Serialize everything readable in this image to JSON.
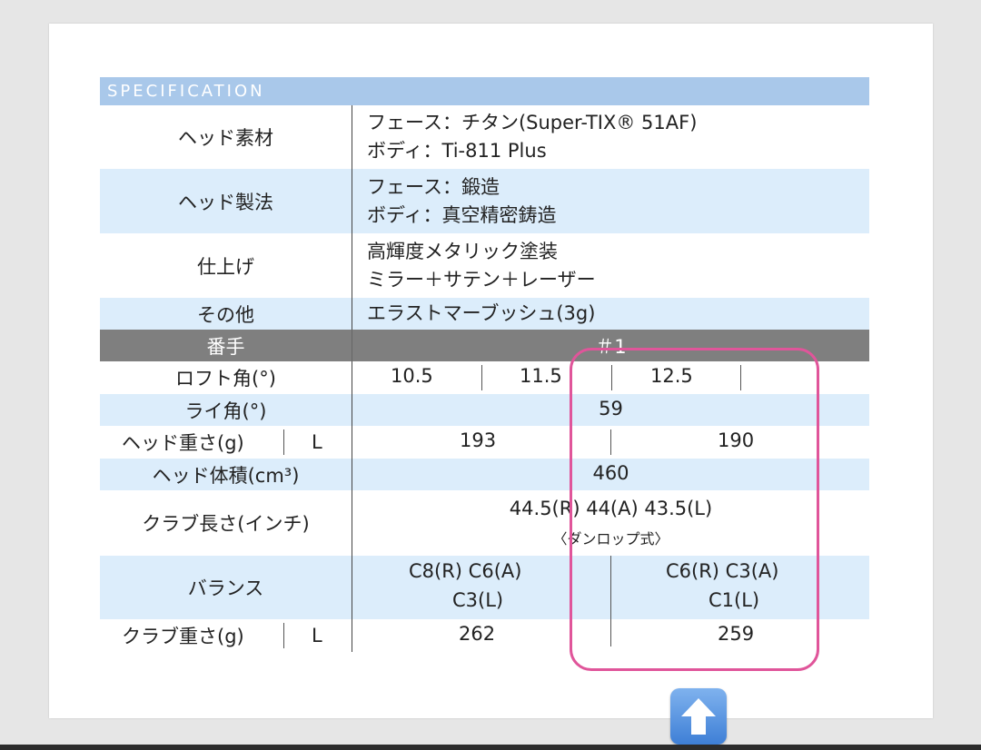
{
  "spec": {
    "header": "SPECIFICATION",
    "head_material": {
      "label": "ヘッド素材",
      "line1": "フェース：チタン(Super-TIX® 51AF)",
      "line2": "ボディ：Ti-811 Plus"
    },
    "head_manufacturing": {
      "label": "ヘッド製法",
      "line1": "フェース：鍛造",
      "line2": "ボディ：真空精密鋳造"
    },
    "finish": {
      "label": "仕上げ",
      "line1": "高輝度メタリック塗装",
      "line2": "ミラー＋サテン＋レーザー"
    },
    "other": {
      "label": "その他",
      "value": "エラストマーブッシュ(3g)"
    },
    "number": {
      "label": "番手",
      "value": "＃1"
    },
    "loft": {
      "label": "ロフト角(°)",
      "values": [
        "10.5",
        "11.5",
        "12.5"
      ]
    },
    "lie": {
      "label": "ライ角(°)",
      "value": "59"
    },
    "head_weight": {
      "label": "ヘッド重さ(g)",
      "flex": "L",
      "left": "193",
      "right": "190"
    },
    "head_volume": {
      "label": "ヘッド体積(cm³)",
      "value": "460"
    },
    "club_length": {
      "label": "クラブ長さ(インチ)",
      "value": "44.5(R)  44(A)  43.5(L)",
      "note": "〈ダンロップ式〉"
    },
    "balance": {
      "label": "バランス",
      "left_line1": "C8(R)  C6(A)",
      "left_line2": "C3(L)",
      "right_line1": "C6(R)  C3(A)",
      "right_line2": "C1(L)"
    },
    "club_weight": {
      "label": "クラブ重さ(g)",
      "flex": "L",
      "left": "262",
      "right": "259"
    }
  },
  "colors": {
    "header_bg": "#a9c8ea",
    "alt_row": "#dcedfb",
    "number_row": "#7f7f7f",
    "highlight": "#e0559a"
  },
  "icons": {
    "up_button": "up-arrow-icon"
  }
}
